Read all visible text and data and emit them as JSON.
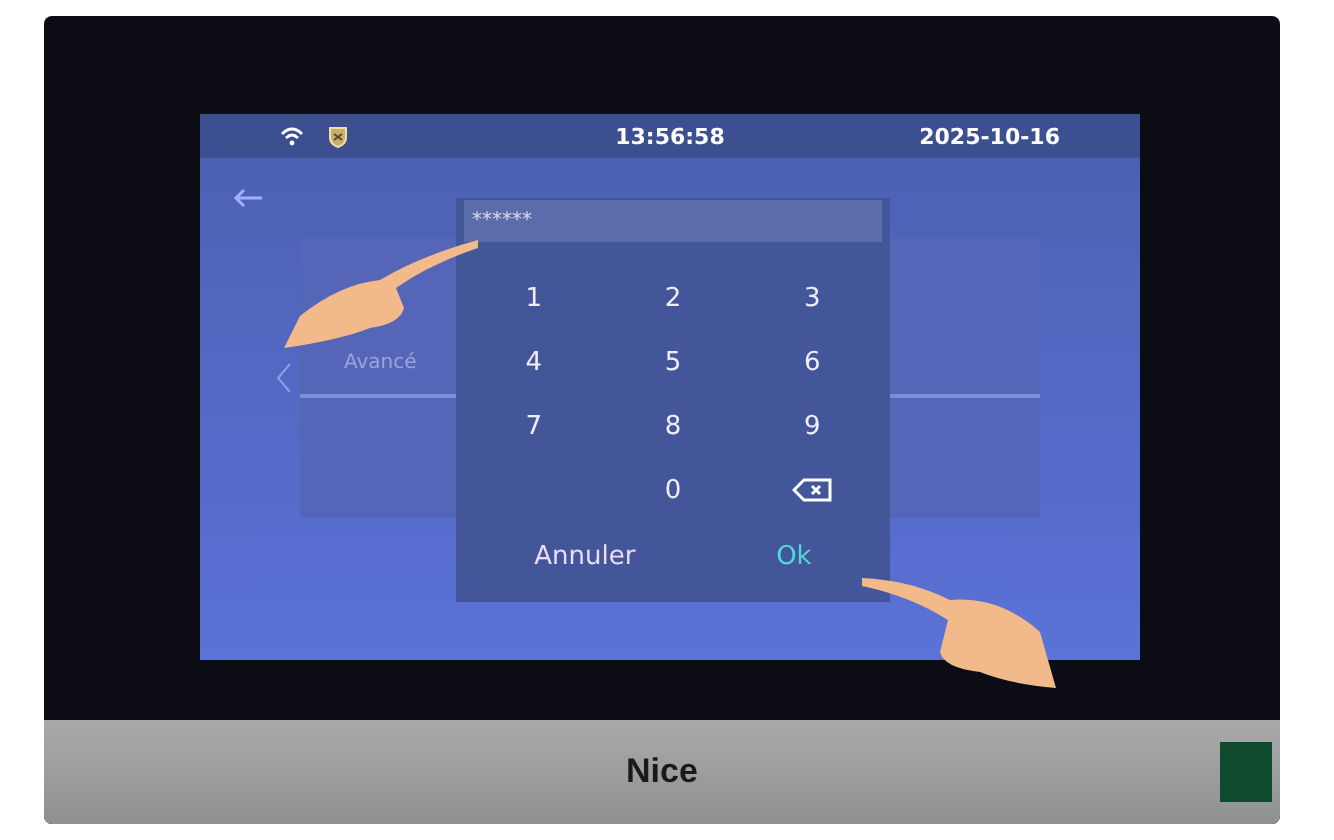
{
  "status_bar": {
    "time": "13:56:58",
    "date": "2025-10-16"
  },
  "background": {
    "card_label": "Avancé"
  },
  "keypad": {
    "field": {
      "value": "******"
    },
    "keys": [
      {
        "kind": "digit",
        "label": "1"
      },
      {
        "kind": "digit",
        "label": "2"
      },
      {
        "kind": "digit",
        "label": "3"
      },
      {
        "kind": "digit",
        "label": "4"
      },
      {
        "kind": "digit",
        "label": "5"
      },
      {
        "kind": "digit",
        "label": "6"
      },
      {
        "kind": "digit",
        "label": "7"
      },
      {
        "kind": "digit",
        "label": "8"
      },
      {
        "kind": "digit",
        "label": "9"
      },
      {
        "kind": "digit",
        "label": "0"
      },
      {
        "kind": "backspace"
      }
    ],
    "actions": [
      {
        "kind": "cancel",
        "label": "Annuler"
      },
      {
        "kind": "confirm",
        "label": "Ok"
      }
    ]
  },
  "device": {
    "brand": "Nice"
  }
}
